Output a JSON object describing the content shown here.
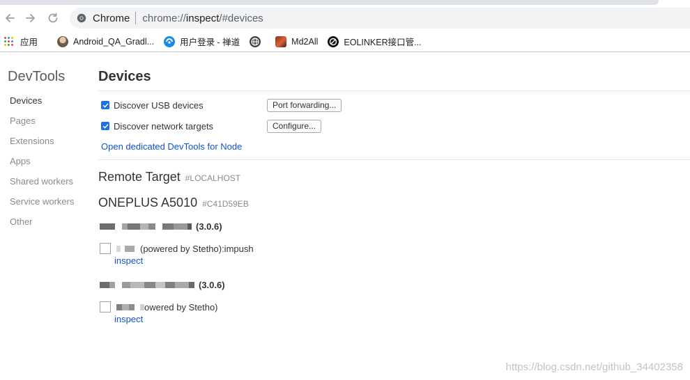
{
  "browser": {
    "omnibox": {
      "chip_label": "Chrome",
      "url_scheme": "chrome://",
      "url_host": "inspect",
      "url_path": "/#devices"
    },
    "bookmarks": [
      {
        "label": "应用",
        "icon": "apps-grid-icon"
      },
      {
        "label": "Android_QA_Gradl...",
        "icon": "avatar-icon"
      },
      {
        "label": "用户登录 - 禅道",
        "icon": "zentao-icon"
      },
      {
        "label": "",
        "icon": "globe-icon"
      },
      {
        "label": "Md2All",
        "icon": "md2all-icon"
      },
      {
        "label": "EOLINKER接口管...",
        "icon": "eolinker-icon"
      }
    ]
  },
  "sidebar": {
    "title": "DevTools",
    "items": [
      {
        "label": "Devices",
        "active": true
      },
      {
        "label": "Pages",
        "active": false
      },
      {
        "label": "Extensions",
        "active": false
      },
      {
        "label": "Apps",
        "active": false
      },
      {
        "label": "Shared workers",
        "active": false
      },
      {
        "label": "Service workers",
        "active": false
      },
      {
        "label": "Other",
        "active": false
      }
    ]
  },
  "main": {
    "title": "Devices",
    "options": {
      "usb_label": "Discover USB devices",
      "usb_checked": true,
      "port_forwarding_button": "Port forwarding...",
      "network_label": "Discover network targets",
      "network_checked": true,
      "configure_button": "Configure...",
      "node_link": "Open dedicated DevTools for Node"
    },
    "remote_target": {
      "title": "Remote Target",
      "subtitle": "#LOCALHOST"
    },
    "device": {
      "name": "ONEPLUS A5010",
      "serial": "#C41D59EB",
      "browsers": [
        {
          "version": "(3.0.6)",
          "target_title": "(powered by Stetho):impush",
          "inspect_label": "inspect"
        },
        {
          "version": "(3.0.6)",
          "target_title": "owered by Stetho)",
          "inspect_label": "inspect"
        }
      ]
    }
  },
  "watermark": "https://blog.csdn.net/github_34402358",
  "colors": {
    "accent": "#1a73e8",
    "link": "#1155cc",
    "sidebar_inactive": "#8a8a8a"
  }
}
